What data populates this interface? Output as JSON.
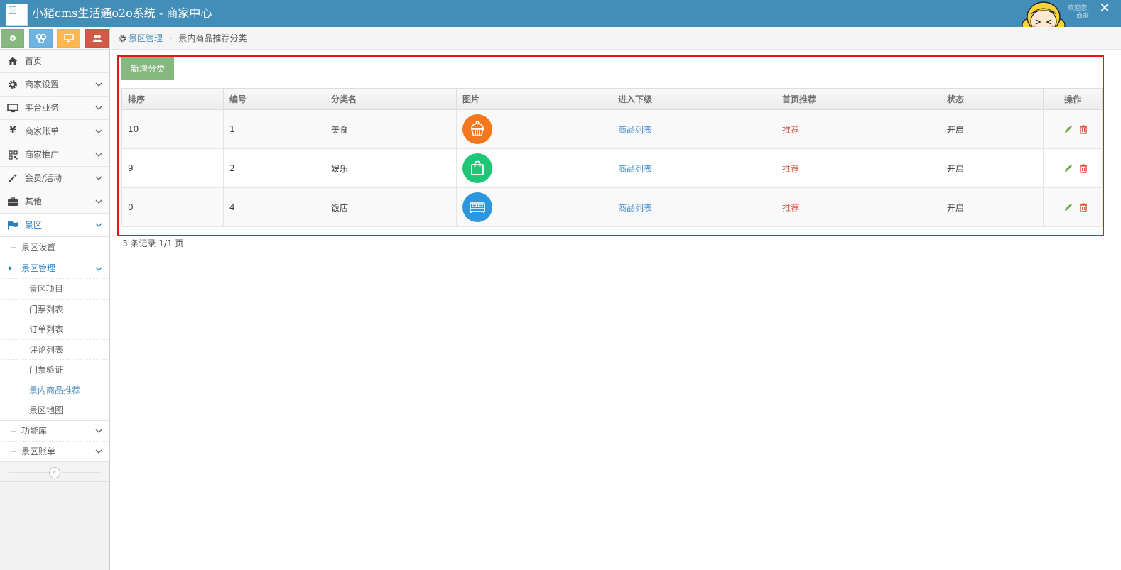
{
  "app": {
    "title": "小猪cms生活通o2o系统 - 商家中心",
    "welcome_text": "欢迎您, 商家",
    "close_glyph": "✕"
  },
  "colors": {
    "navbar": "#438eb9",
    "shortcut_green": "#87b87f",
    "shortcut_blue": "#6fb3e0",
    "shortcut_orange": "#ffb752",
    "shortcut_red": "#d15b47",
    "highlight_border": "#e11111",
    "thumb_food": "#f5781f",
    "thumb_fun": "#1ec776",
    "thumb_hotel": "#2c96de"
  },
  "shortcuts": [
    {
      "icon": "gear-icon",
      "color": "#87b87f"
    },
    {
      "icon": "share-icon",
      "color": "#6fb3e0"
    },
    {
      "icon": "monitor-icon",
      "color": "#ffb752"
    },
    {
      "icon": "users-icon",
      "color": "#d15b47"
    }
  ],
  "sidebar": {
    "items": [
      {
        "label": "首页",
        "icon": "home-icon"
      },
      {
        "label": "商家设置",
        "icon": "gear-icon"
      },
      {
        "label": "平台业务",
        "icon": "monitor-icon"
      },
      {
        "label": "商家账单",
        "icon": "yen-icon"
      },
      {
        "label": "商家推广",
        "icon": "qrcode-icon"
      },
      {
        "label": "会员/活动",
        "icon": "magic-wand-icon"
      },
      {
        "label": "其他",
        "icon": "briefcase-icon"
      },
      {
        "label": "景区",
        "icon": "flag-icon"
      }
    ],
    "scenic_sub": {
      "settings": "景区设置",
      "management": "景区管理",
      "management_children": [
        "景区项目",
        "门票列表",
        "订单列表",
        "评论列表",
        "门票验证",
        "景内商品推荐",
        "景区地图"
      ],
      "function_lib": "功能库",
      "bill": "景区账单"
    },
    "collapse_glyph": "«"
  },
  "breadcrumb": {
    "parent": "景区管理",
    "separator": "›",
    "current": "景内商品推荐分类"
  },
  "main": {
    "add_button": "新增分类",
    "table": {
      "headers": [
        "排序",
        "编号",
        "分类名",
        "图片",
        "进入下级",
        "首页推荐",
        "状态",
        "操作"
      ],
      "rows": [
        {
          "sort": "10",
          "id": "1",
          "name": "美食",
          "image": "cupcake-icon",
          "sub_link": "商品列表",
          "recommend": "推荐",
          "status": "开启"
        },
        {
          "sort": "9",
          "id": "2",
          "name": "娱乐",
          "image": "shopping-bag-icon",
          "sub_link": "商品列表",
          "recommend": "推荐",
          "status": "开启"
        },
        {
          "sort": "0",
          "id": "4",
          "name": "饭店",
          "image": "bed-icon",
          "sub_link": "商品列表",
          "recommend": "推荐",
          "status": "开启"
        }
      ]
    },
    "pager": "3 条记录 1/1 页"
  }
}
